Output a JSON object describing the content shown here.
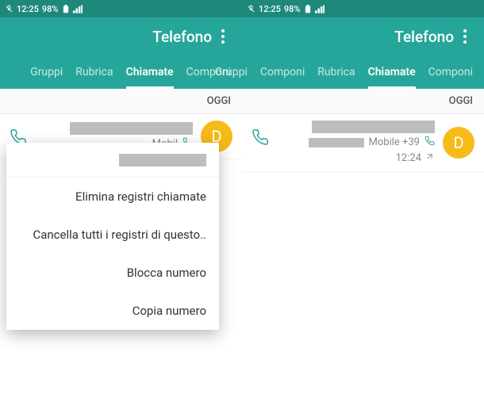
{
  "status": {
    "time": "12:25",
    "battery": "98%"
  },
  "header": {
    "title": "Telefono"
  },
  "tabs": {
    "componi": "Componi",
    "chiamate": "Chiamate",
    "rubrica": "Rubrica",
    "componi2": "Componi",
    "gruppi": "Gruppi"
  },
  "section": {
    "today": "OGGI"
  },
  "call": {
    "avatar_letter": "D",
    "mobile_label": "Mobile +39",
    "mobile_label_short": "Mobil",
    "time": "12:24"
  },
  "menu": {
    "item1": "Elimina registri chiamate",
    "item2": "Cancella tutti i registri di questo..",
    "item3": "Blocca numero",
    "item4": "Copia numero"
  }
}
